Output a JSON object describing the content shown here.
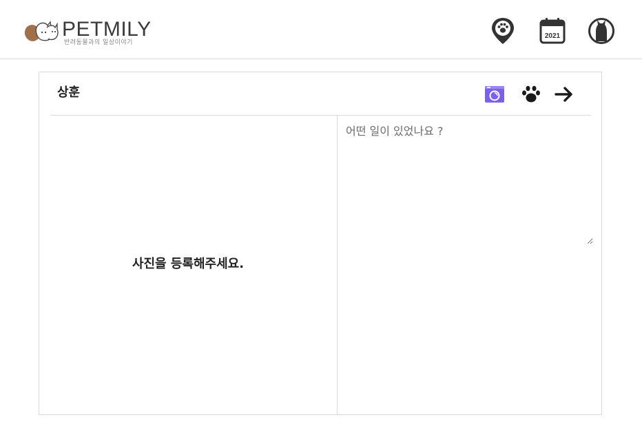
{
  "header": {
    "brand": "PETMILY",
    "tagline": "반려동물과의 일상이야기",
    "nav": [
      {
        "name": "map-pin-paw-icon"
      },
      {
        "name": "calendar-icon",
        "label": "2021"
      },
      {
        "name": "profile-cat-icon"
      }
    ]
  },
  "post": {
    "user_name": "상훈",
    "actions": [
      {
        "name": "camera-icon",
        "color": "#7b61e8"
      },
      {
        "name": "paw-icon",
        "color": "#1a1a1a"
      },
      {
        "name": "arrow-right-icon",
        "color": "#1a1a1a"
      }
    ],
    "photo_placeholder": "사진을 등록해주세요.",
    "content_placeholder": "어떤 일이 있었나요 ?",
    "content_value": ""
  },
  "colors": {
    "accent": "#7b61e8",
    "border": "#d8d8d8",
    "logo_brown": "#a0704b"
  }
}
